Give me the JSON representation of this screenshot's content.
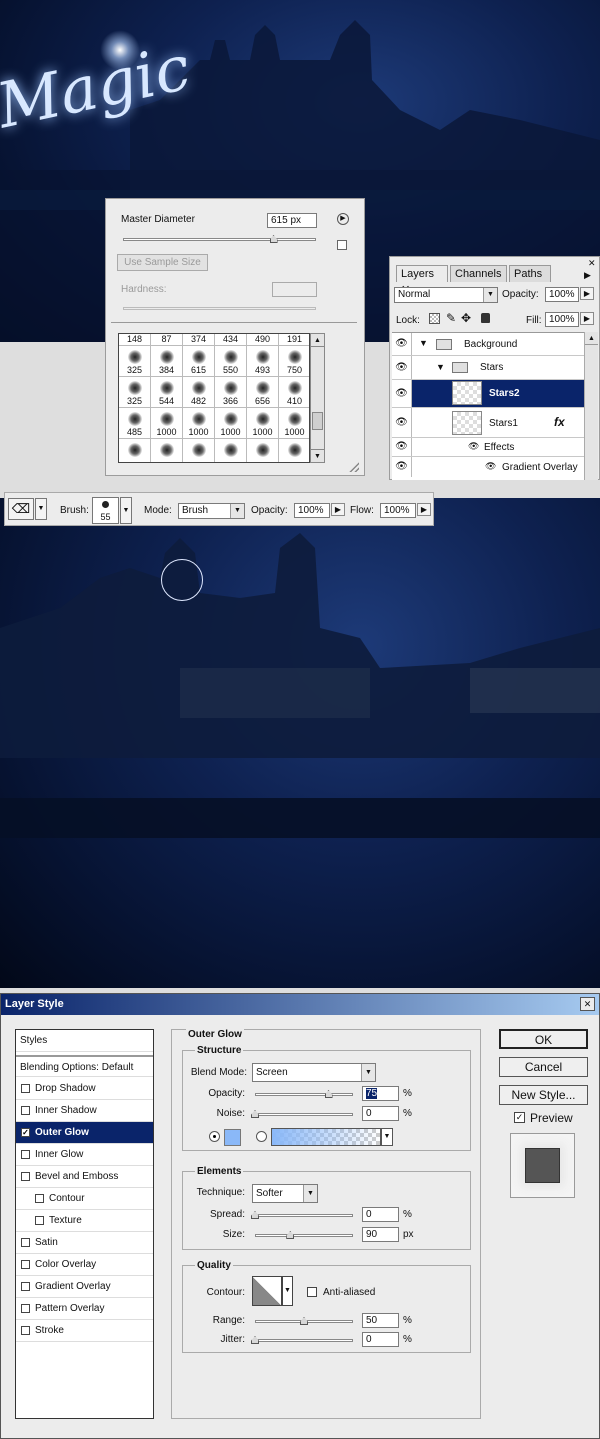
{
  "top_scene": {
    "title_text": "Magic"
  },
  "brush_picker": {
    "master_diameter_label": "Master Diameter",
    "master_diameter_value": "615 px",
    "master_diameter_fraction": 0.78,
    "use_sample_size_label": "Use Sample Size",
    "hardness_label": "Hardness:",
    "header_row": [
      "148",
      "87",
      "374",
      "434",
      "490",
      "191"
    ],
    "rows": [
      [
        "325",
        "384",
        "615",
        "550",
        "493",
        "750"
      ],
      [
        "325",
        "544",
        "482",
        "366",
        "656",
        "410"
      ],
      [
        "485",
        "1000",
        "1000",
        "1000",
        "1000",
        "1000"
      ],
      [
        "",
        "",
        "",
        "",
        "",
        ""
      ]
    ]
  },
  "layers_panel": {
    "tabs": [
      "Layers",
      "Channels",
      "Paths"
    ],
    "blend_mode": "Normal",
    "opacity_label": "Opacity:",
    "opacity_value": "100%",
    "lock_label": "Lock:",
    "fill_label": "Fill:",
    "fill_value": "100%",
    "layers": [
      {
        "name": "Background",
        "kind": "group"
      },
      {
        "name": "Stars",
        "kind": "group"
      },
      {
        "name": "Stars2",
        "kind": "layer",
        "selected": true
      },
      {
        "name": "Stars1",
        "kind": "layer",
        "fx": "fx"
      }
    ],
    "effects_label": "Effects",
    "effect_item": "Gradient Overlay"
  },
  "options_bar": {
    "brush_label": "Brush:",
    "brush_size": "55",
    "mode_label": "Mode:",
    "mode_value": "Brush",
    "opacity_label": "Opacity:",
    "opacity_value": "100%",
    "flow_label": "Flow:",
    "flow_value": "100%"
  },
  "layer_style": {
    "title": "Layer Style",
    "styles_header": "Styles",
    "blending_options": "Blending Options: Default",
    "style_items": [
      {
        "label": "Drop Shadow",
        "checked": false,
        "indent": false
      },
      {
        "label": "Inner Shadow",
        "checked": false,
        "indent": false
      },
      {
        "label": "Outer Glow",
        "checked": true,
        "indent": false,
        "selected": true
      },
      {
        "label": "Inner Glow",
        "checked": false,
        "indent": false
      },
      {
        "label": "Bevel and Emboss",
        "checked": false,
        "indent": false
      },
      {
        "label": "Contour",
        "checked": false,
        "indent": true
      },
      {
        "label": "Texture",
        "checked": false,
        "indent": true
      },
      {
        "label": "Satin",
        "checked": false,
        "indent": false
      },
      {
        "label": "Color Overlay",
        "checked": false,
        "indent": false
      },
      {
        "label": "Gradient Overlay",
        "checked": false,
        "indent": false
      },
      {
        "label": "Pattern Overlay",
        "checked": false,
        "indent": false
      },
      {
        "label": "Stroke",
        "checked": false,
        "indent": false
      }
    ],
    "section_title": "Outer Glow",
    "structure": {
      "title": "Structure",
      "blend_mode_label": "Blend Mode:",
      "blend_mode_value": "Screen",
      "opacity_label": "Opacity:",
      "opacity_value": "75",
      "opacity_unit": "%",
      "opacity_fraction": 0.75,
      "noise_label": "Noise:",
      "noise_value": "0",
      "noise_unit": "%",
      "noise_fraction": 0,
      "glow_color": "#8ab8f8"
    },
    "elements": {
      "title": "Elements",
      "technique_label": "Technique:",
      "technique_value": "Softer",
      "spread_label": "Spread:",
      "spread_value": "0",
      "spread_unit": "%",
      "spread_fraction": 0,
      "size_label": "Size:",
      "size_value": "90",
      "size_unit": "px",
      "size_fraction": 0.36
    },
    "quality": {
      "title": "Quality",
      "contour_label": "Contour:",
      "anti_aliased_label": "Anti-aliased",
      "range_label": "Range:",
      "range_value": "50",
      "range_unit": "%",
      "range_fraction": 0.5,
      "jitter_label": "Jitter:",
      "jitter_value": "0",
      "jitter_unit": "%",
      "jitter_fraction": 0
    },
    "buttons": {
      "ok": "OK",
      "cancel": "Cancel",
      "new_style": "New Style..."
    },
    "preview_label": "Preview",
    "preview_checked": true
  }
}
